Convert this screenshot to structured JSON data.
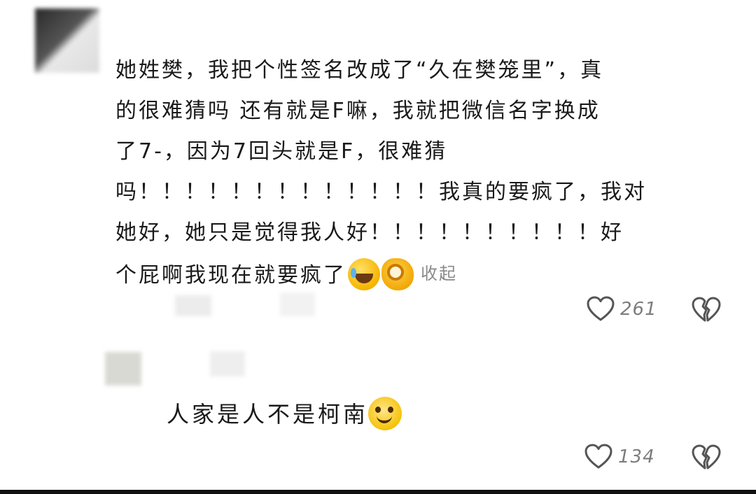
{
  "comment": {
    "lines": [
      "她姓樊，我把个性签名改成了“久在樊笼里”，真",
      "的很难猜吗     还有就是F嘛，我就把微信名字换成",
      "了7-，因为7回头就是F，很难猜",
      "吗！！！！！！！！！！！！！我真的要疯了，我对",
      "她好，她只是觉得我人好！！！！！！！！！！好",
      "个屁啊我现在就要疯了"
    ],
    "emojis": [
      "laugh-tears-emoji",
      "ok-hand-emoji"
    ],
    "collapse_label": "收起",
    "likes": "261"
  },
  "reply": {
    "text": "人家是人不是柯南",
    "emoji": "smile-emoji",
    "likes": "134"
  },
  "icons": {
    "like": "heart-outline-icon",
    "dislike": "broken-heart-icon"
  }
}
